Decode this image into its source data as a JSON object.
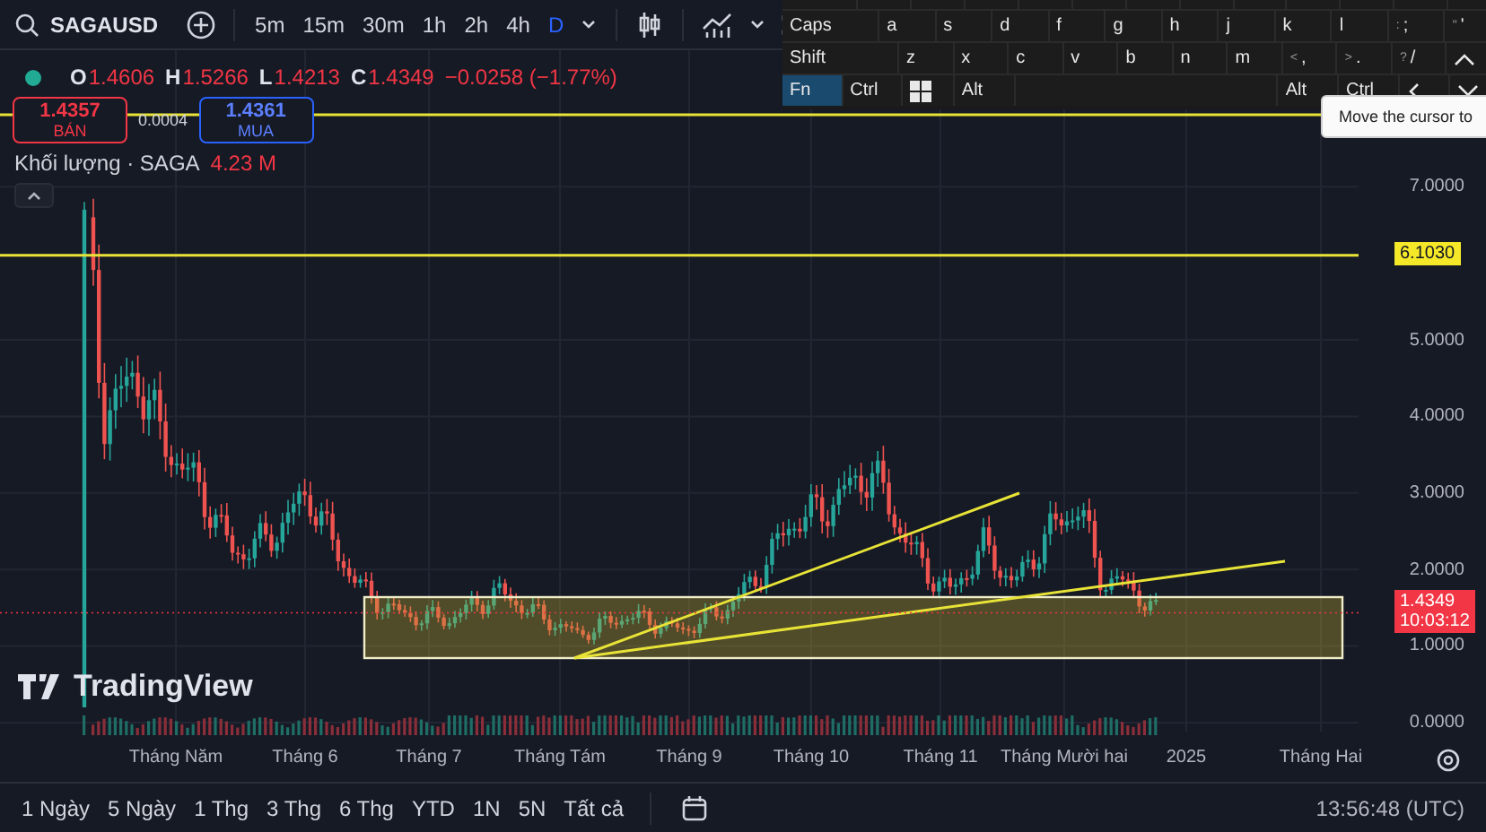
{
  "toolbar": {
    "symbol": "SAGAUSD",
    "intervals": [
      {
        "label": "5m",
        "selected": false
      },
      {
        "label": "15m",
        "selected": false
      },
      {
        "label": "30m",
        "selected": false
      },
      {
        "label": "1h",
        "selected": false
      },
      {
        "label": "2h",
        "selected": false
      },
      {
        "label": "4h",
        "selected": false
      },
      {
        "label": "D",
        "selected": true
      }
    ]
  },
  "legend": {
    "ohlc": [
      {
        "key": "O",
        "value": "1.4606"
      },
      {
        "key": "H",
        "value": "1.5266"
      },
      {
        "key": "L",
        "value": "1.4213"
      },
      {
        "key": "C",
        "value": "1.4349"
      }
    ],
    "change": "−0.0258 (−1.77%)",
    "bid": {
      "price": "1.4357",
      "label": "BÁN"
    },
    "spread": "0.0004",
    "ask": {
      "price": "1.4361",
      "label": "MUA"
    },
    "volume": {
      "label": "Khối lượng · SAGA",
      "value": "4.23 M"
    }
  },
  "price_axis": {
    "labels": [
      "7.0000",
      "5.0000",
      "4.0000",
      "3.0000",
      "2.0000",
      "1.0000",
      "0.0000"
    ],
    "line_tag": "6.1030",
    "last_price": "1.4349",
    "countdown": "10:03:12"
  },
  "time_axis": {
    "labels": [
      "Tháng Năm",
      "Tháng 6",
      "Tháng 7",
      "Tháng Tám",
      "Tháng 9",
      "Tháng 10",
      "Tháng 11",
      "Tháng Mười hai",
      "2025",
      "Tháng Hai"
    ]
  },
  "logo": "TradingView",
  "ranges": [
    "1 Ngày",
    "5 Ngày",
    "1 Thg",
    "3 Thg",
    "6 Thg",
    "YTD",
    "1N",
    "5N",
    "Tất cả"
  ],
  "clock": "13:56:48 (UTC)",
  "keyboard": {
    "rows": [
      {
        "keys": [
          {
            "kind": "caps",
            "label": "Caps",
            "pressed": false
          },
          {
            "kind": "letter",
            "label": "a",
            "pressed": false
          },
          {
            "kind": "letter",
            "label": "s",
            "pressed": false
          },
          {
            "kind": "letter",
            "label": "d",
            "pressed": false
          },
          {
            "kind": "letter",
            "label": "f",
            "pressed": false
          },
          {
            "kind": "letter",
            "label": "g",
            "pressed": false
          },
          {
            "kind": "letter",
            "label": "h",
            "pressed": false
          },
          {
            "kind": "letter",
            "label": "j",
            "pressed": false
          },
          {
            "kind": "letter",
            "label": "k",
            "pressed": false
          },
          {
            "kind": "letter",
            "label": "l",
            "pressed": false
          },
          {
            "kind": "letter",
            "label": ";",
            "shifted": ":",
            "pressed": false
          },
          {
            "kind": "letter",
            "label": "'",
            "shifted": "\"",
            "pressed": false
          }
        ]
      },
      {
        "keys": [
          {
            "kind": "shift",
            "label": "Shift",
            "pressed": false
          },
          {
            "kind": "letter",
            "label": "z",
            "pressed": false
          },
          {
            "kind": "letter",
            "label": "x",
            "pressed": false
          },
          {
            "kind": "letter",
            "label": "c",
            "pressed": false
          },
          {
            "kind": "letter",
            "label": "v",
            "pressed": false
          },
          {
            "kind": "letter",
            "label": "b",
            "pressed": false
          },
          {
            "kind": "letter",
            "label": "n",
            "pressed": false
          },
          {
            "kind": "letter",
            "label": "m",
            "pressed": false
          },
          {
            "kind": "letter",
            "label": ",",
            "shifted": "<",
            "pressed": false
          },
          {
            "kind": "letter",
            "label": ".",
            "shifted": ">",
            "pressed": false
          },
          {
            "kind": "letter",
            "label": "/",
            "shifted": "?",
            "pressed": false
          },
          {
            "kind": "arrow-up",
            "pressed": false
          }
        ]
      },
      {
        "keys": [
          {
            "kind": "mod",
            "label": "Fn",
            "pressed": true
          },
          {
            "kind": "mod",
            "label": "Ctrl",
            "pressed": false
          },
          {
            "kind": "windows",
            "pressed": false
          },
          {
            "kind": "mod",
            "label": "Alt",
            "pressed": false
          },
          {
            "kind": "space",
            "pressed": false
          },
          {
            "kind": "mod",
            "label": "Alt",
            "pressed": false
          },
          {
            "kind": "mod",
            "label": "Ctrl",
            "pressed": false
          },
          {
            "kind": "arrow-left",
            "pressed": false
          },
          {
            "kind": "arrow-down",
            "pressed": false
          }
        ]
      }
    ]
  },
  "tooltip": "Move the cursor to"
}
